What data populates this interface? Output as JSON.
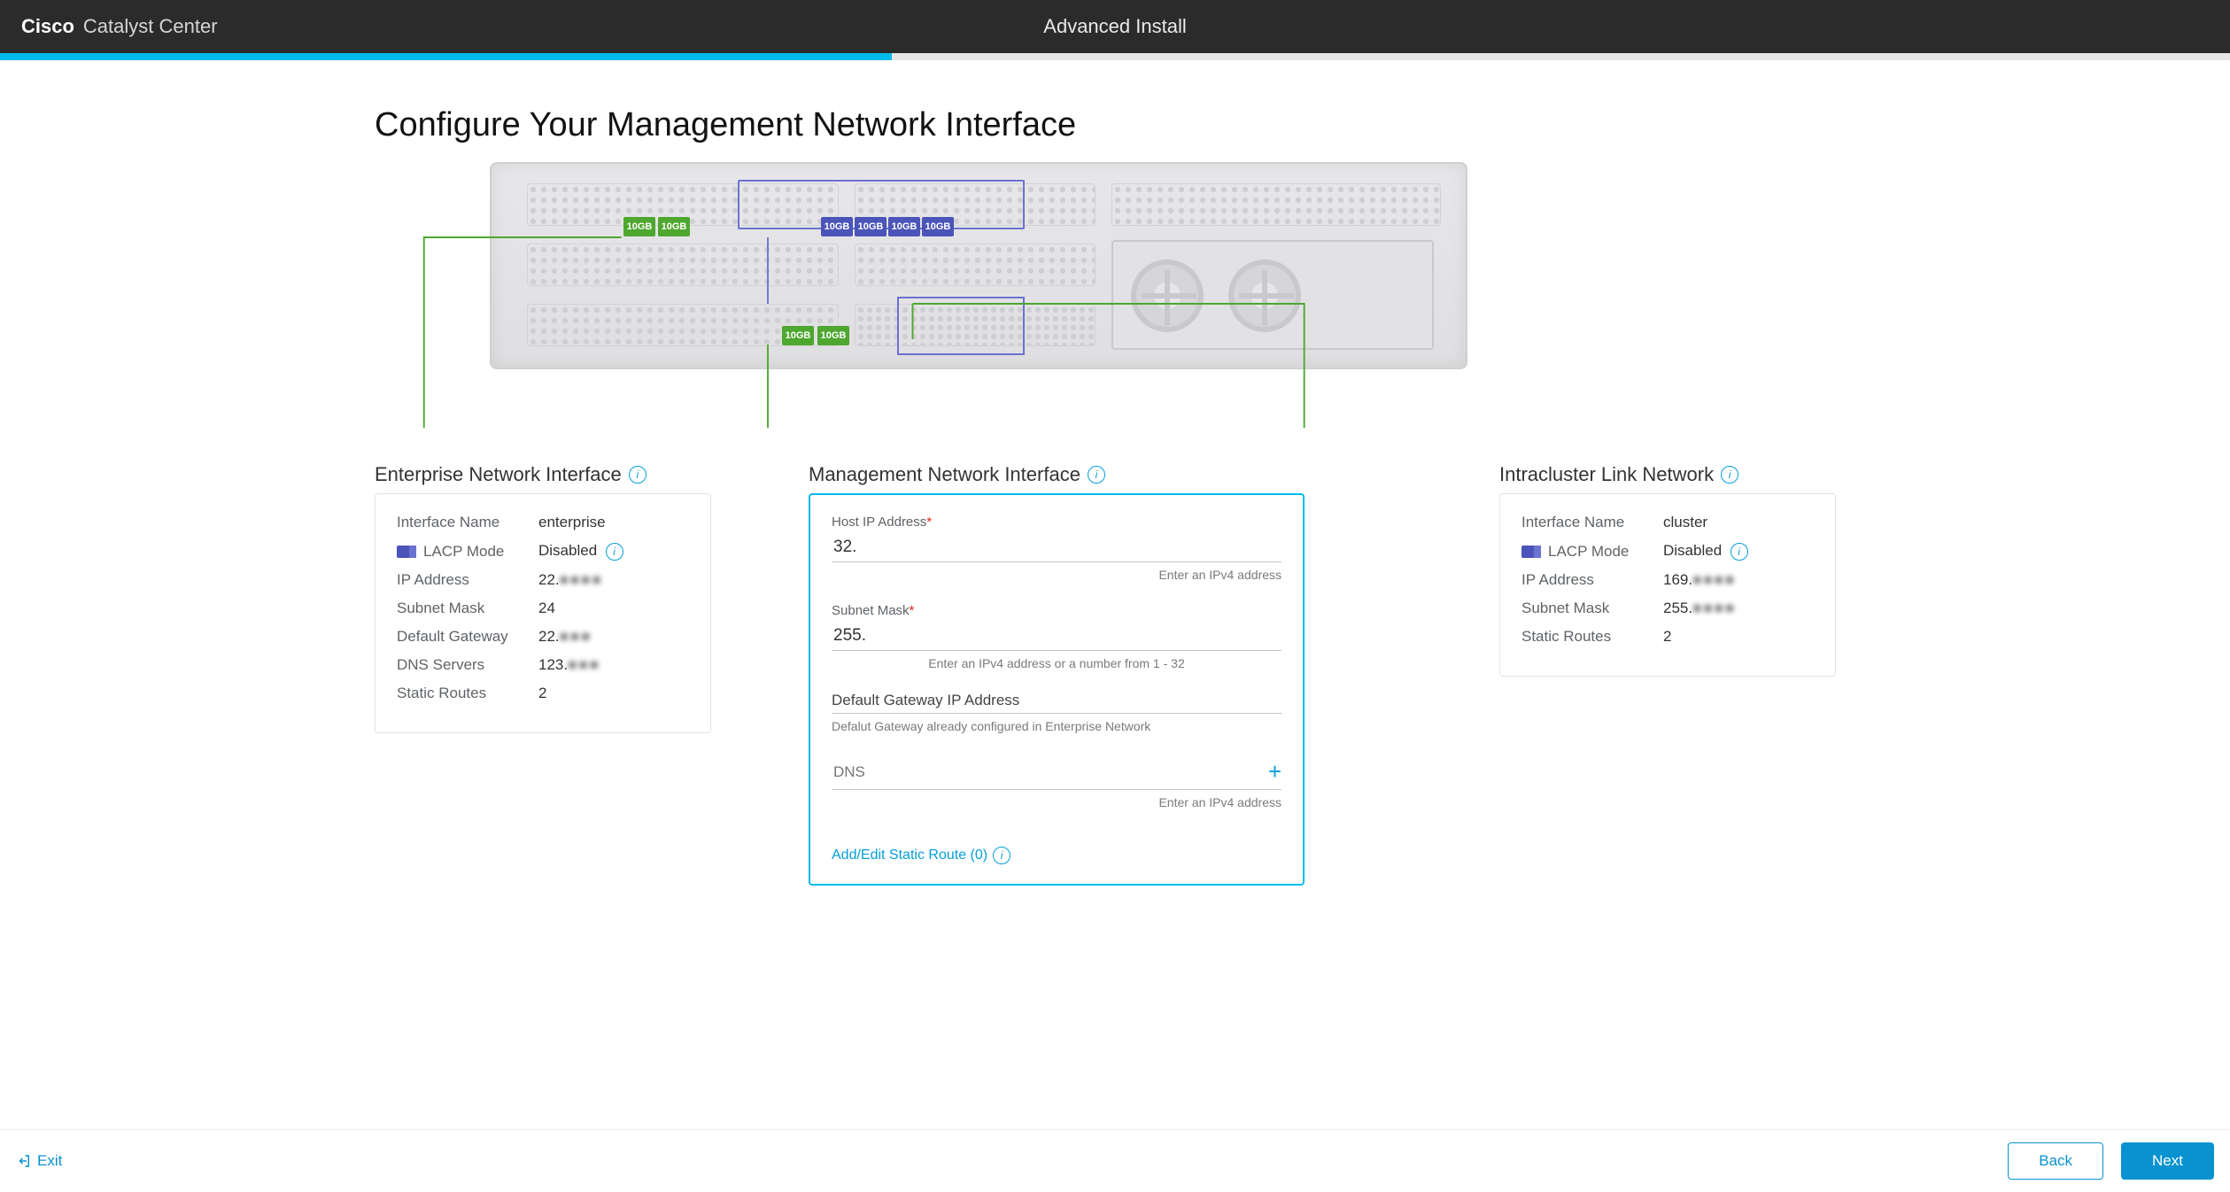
{
  "header": {
    "brand_bold": "Cisco",
    "brand_light": "Catalyst Center",
    "title": "Advanced Install",
    "progress_pct": 40
  },
  "page": {
    "title": "Configure Your Management Network Interface"
  },
  "chassis": {
    "port_label": "10GB"
  },
  "enterprise": {
    "title": "Enterprise Network Interface",
    "fields": {
      "interface_name_label": "Interface Name",
      "interface_name_value": "enterprise",
      "lacp_mode_label": "LACP Mode",
      "lacp_mode_value": "Disabled",
      "ip_address_label": "IP Address",
      "ip_address_value": "22.",
      "subnet_mask_label": "Subnet Mask",
      "subnet_mask_value": "24",
      "default_gateway_label": "Default Gateway",
      "default_gateway_value": "22.",
      "dns_servers_label": "DNS Servers",
      "dns_servers_value": "123.",
      "static_routes_label": "Static Routes",
      "static_routes_value": "2"
    }
  },
  "management": {
    "title": "Management Network Interface",
    "host_ip": {
      "label": "Host IP Address",
      "required": "*",
      "value": "32.",
      "hint": "Enter an IPv4 address"
    },
    "subnet": {
      "label": "Subnet Mask",
      "required": "*",
      "value": "255.",
      "hint": "Enter an IPv4 address or a number from 1 - 32"
    },
    "gateway": {
      "label": "Default Gateway IP Address",
      "hint": "Defalut Gateway already configured in Enterprise Network"
    },
    "dns": {
      "label": "DNS",
      "hint": "Enter an IPv4 address"
    },
    "static_route_link": "Add/Edit Static Route (0)"
  },
  "cluster": {
    "title": "Intracluster Link Network",
    "fields": {
      "interface_name_label": "Interface Name",
      "interface_name_value": "cluster",
      "lacp_mode_label": "LACP Mode",
      "lacp_mode_value": "Disabled",
      "ip_address_label": "IP Address",
      "ip_address_value": "169.",
      "subnet_mask_label": "Subnet Mask",
      "subnet_mask_value": "255.",
      "static_routes_label": "Static Routes",
      "static_routes_value": "2"
    }
  },
  "footer": {
    "exit": "Exit",
    "back": "Back",
    "next": "Next"
  }
}
